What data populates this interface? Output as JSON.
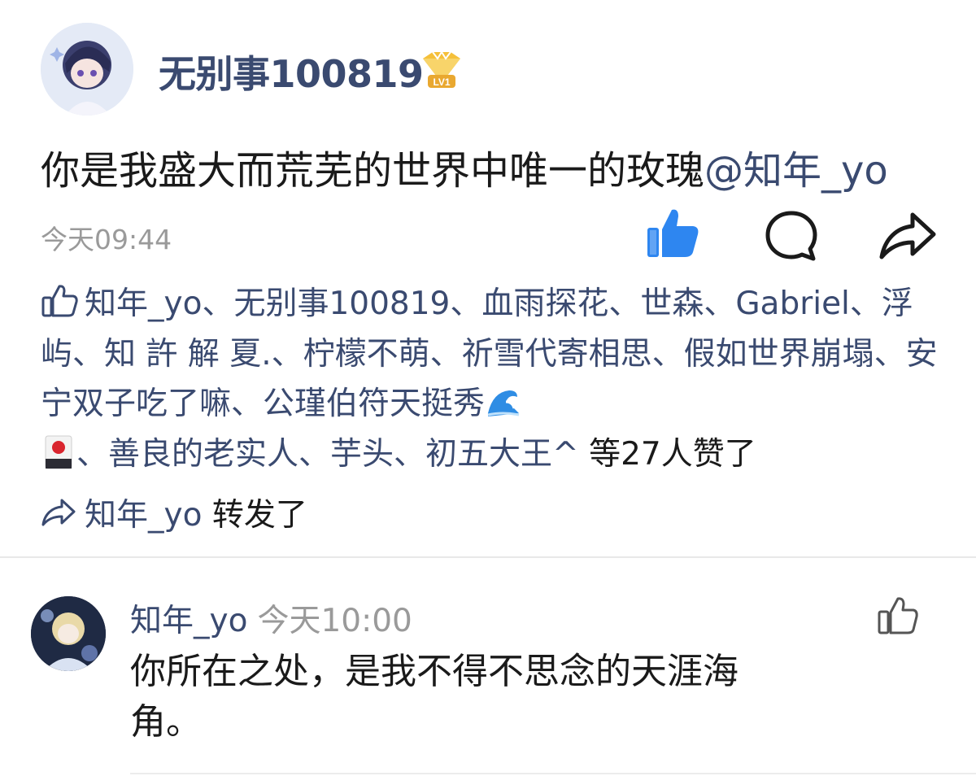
{
  "post": {
    "username": "无别事100819",
    "level_badge": "LV1",
    "text": "你是我盛大而荒芜的世界中唯一的玫瑰",
    "mention": "@知年_yo",
    "time": "今天09:44",
    "actions": {
      "like_icon": "thumbs-up-filled-icon",
      "comment_icon": "comment-bubble-icon",
      "share_icon": "share-arrow-icon",
      "like_color": "#2e86f0"
    }
  },
  "likes": {
    "icon": "thumbs-up-outline-icon",
    "names_part1": "知年_yo、无别事100819、血雨探花、世森、Gabriel、浮屿、知 許 解 夏.、柠檬不萌、祈雪代寄相思、假如世界崩塌、安宁双子吃了嘛、公瑾伯符天挺秀",
    "emoji_wave": "wave-emoji",
    "emoji_card": "flower-card-emoji",
    "names_part2": "、善良的老实人、芋头、初五大王^",
    "count_text": " 等27人赞了"
  },
  "repost": {
    "icon": "share-outline-icon",
    "user": "知年_yo",
    "action": " 转发了"
  },
  "comment": {
    "user": "知年_yo",
    "time": "今天10:00",
    "text": "你所在之处，是我不得不思念的天涯海角。",
    "like_icon": "thumbs-up-outline-icon"
  },
  "colors": {
    "name_blue": "#3a4a70",
    "meta_gray": "#9a9a9a",
    "like_blue": "#2e86f0"
  }
}
